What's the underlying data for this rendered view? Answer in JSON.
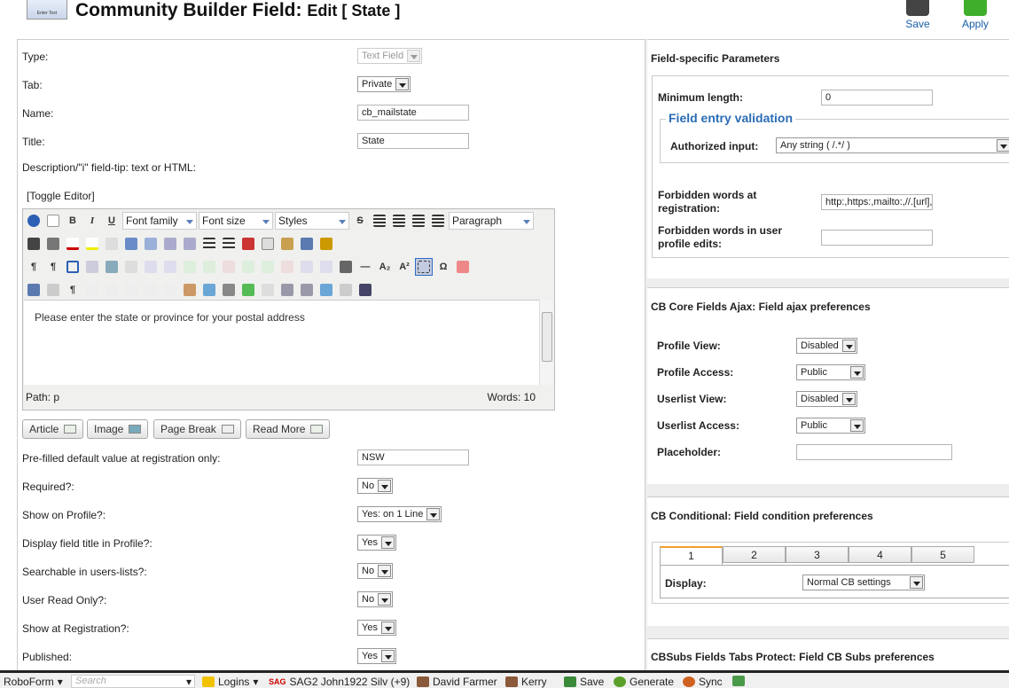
{
  "header": {
    "logo_text": "Enter Text",
    "title_main": "Community Builder Field:",
    "title_sub": "Edit [ State ]",
    "save_label": "Save",
    "apply_label": "Apply"
  },
  "form": {
    "type_label": "Type:",
    "type_value": "Text Field",
    "tab_label": "Tab:",
    "tab_value": "Private",
    "name_label": "Name:",
    "name_value": "cb_mailstate",
    "title_label": "Title:",
    "title_value": "State",
    "desc_label": "Description/\"i\" field-tip: text or HTML:",
    "toggle_editor": "[Toggle Editor]",
    "prefilled_label": "Pre-filled default value at registration only:",
    "prefilled_value": "NSW",
    "required_label": "Required?:",
    "required_value": "No",
    "show_profile_label": "Show on Profile?:",
    "show_profile_value": "Yes: on 1 Line",
    "display_title_label": "Display field title in Profile?:",
    "display_title_value": "Yes",
    "searchable_label": "Searchable in users-lists?:",
    "searchable_value": "No",
    "read_only_label": "User Read Only?:",
    "read_only_value": "No",
    "show_reg_label": "Show at Registration?:",
    "show_reg_value": "Yes",
    "published_label": "Published:",
    "published_value": "Yes"
  },
  "editor": {
    "font_family": "Font family",
    "font_size": "Font size",
    "styles": "Styles",
    "format": "Paragraph",
    "content": "Please enter the state or province for your postal address",
    "path": "Path:  p",
    "words": "Words: 10",
    "btn_bold": "B",
    "btn_italic": "I",
    "btn_underline": "U",
    "btn_strike": "S",
    "btn_sub": "A₂",
    "btn_sup": "A²",
    "btn_omega": "Ω"
  },
  "extra_buttons": {
    "article": "Article",
    "image": "Image",
    "page_break": "Page Break",
    "read_more": "Read More"
  },
  "params": {
    "heading": "Field-specific Parameters",
    "min_length_label": "Minimum length:",
    "min_length_value": "0",
    "validation_legend": "Field entry validation",
    "authorized_label": "Authorized input:",
    "authorized_value": "Any string ( /.*/ )",
    "forbidden_reg_label": "Forbidden words at registration:",
    "forbidden_reg_value": "http:,https:,mailto:,//.[url],<",
    "forbidden_edit_label": "Forbidden words in user profile edits:",
    "forbidden_edit_value": ""
  },
  "ajax": {
    "heading": "CB Core Fields Ajax: Field ajax preferences",
    "profile_view_label": "Profile View:",
    "profile_view_value": "Disabled",
    "profile_access_label": "Profile Access:",
    "profile_access_value": "Public",
    "userlist_view_label": "Userlist View:",
    "userlist_view_value": "Disabled",
    "userlist_access_label": "Userlist Access:",
    "userlist_access_value": "Public",
    "placeholder_label": "Placeholder:",
    "placeholder_value": ""
  },
  "conditional": {
    "heading": "CB Conditional: Field condition preferences",
    "tabs": [
      "1",
      "2",
      "3",
      "4",
      "5"
    ],
    "display_label": "Display:",
    "display_value": "Normal CB settings"
  },
  "cbsubs": {
    "heading": "CBSubs Fields Tabs Protect: Field CB Subs preferences"
  },
  "taskbar": {
    "roboform": "RoboForm",
    "search_placeholder": "Search",
    "logins": "Logins",
    "sag_prefix": "SAG",
    "sag": "SAG2 John1922 Silv (+9)",
    "david": "David Farmer",
    "kerry": "Kerry",
    "save": "Save",
    "generate": "Generate",
    "sync": "Sync"
  },
  "colors": {
    "accent": "#2a6cb5",
    "tab_active": "#f0a030",
    "apply_green": "#3fae2a"
  }
}
